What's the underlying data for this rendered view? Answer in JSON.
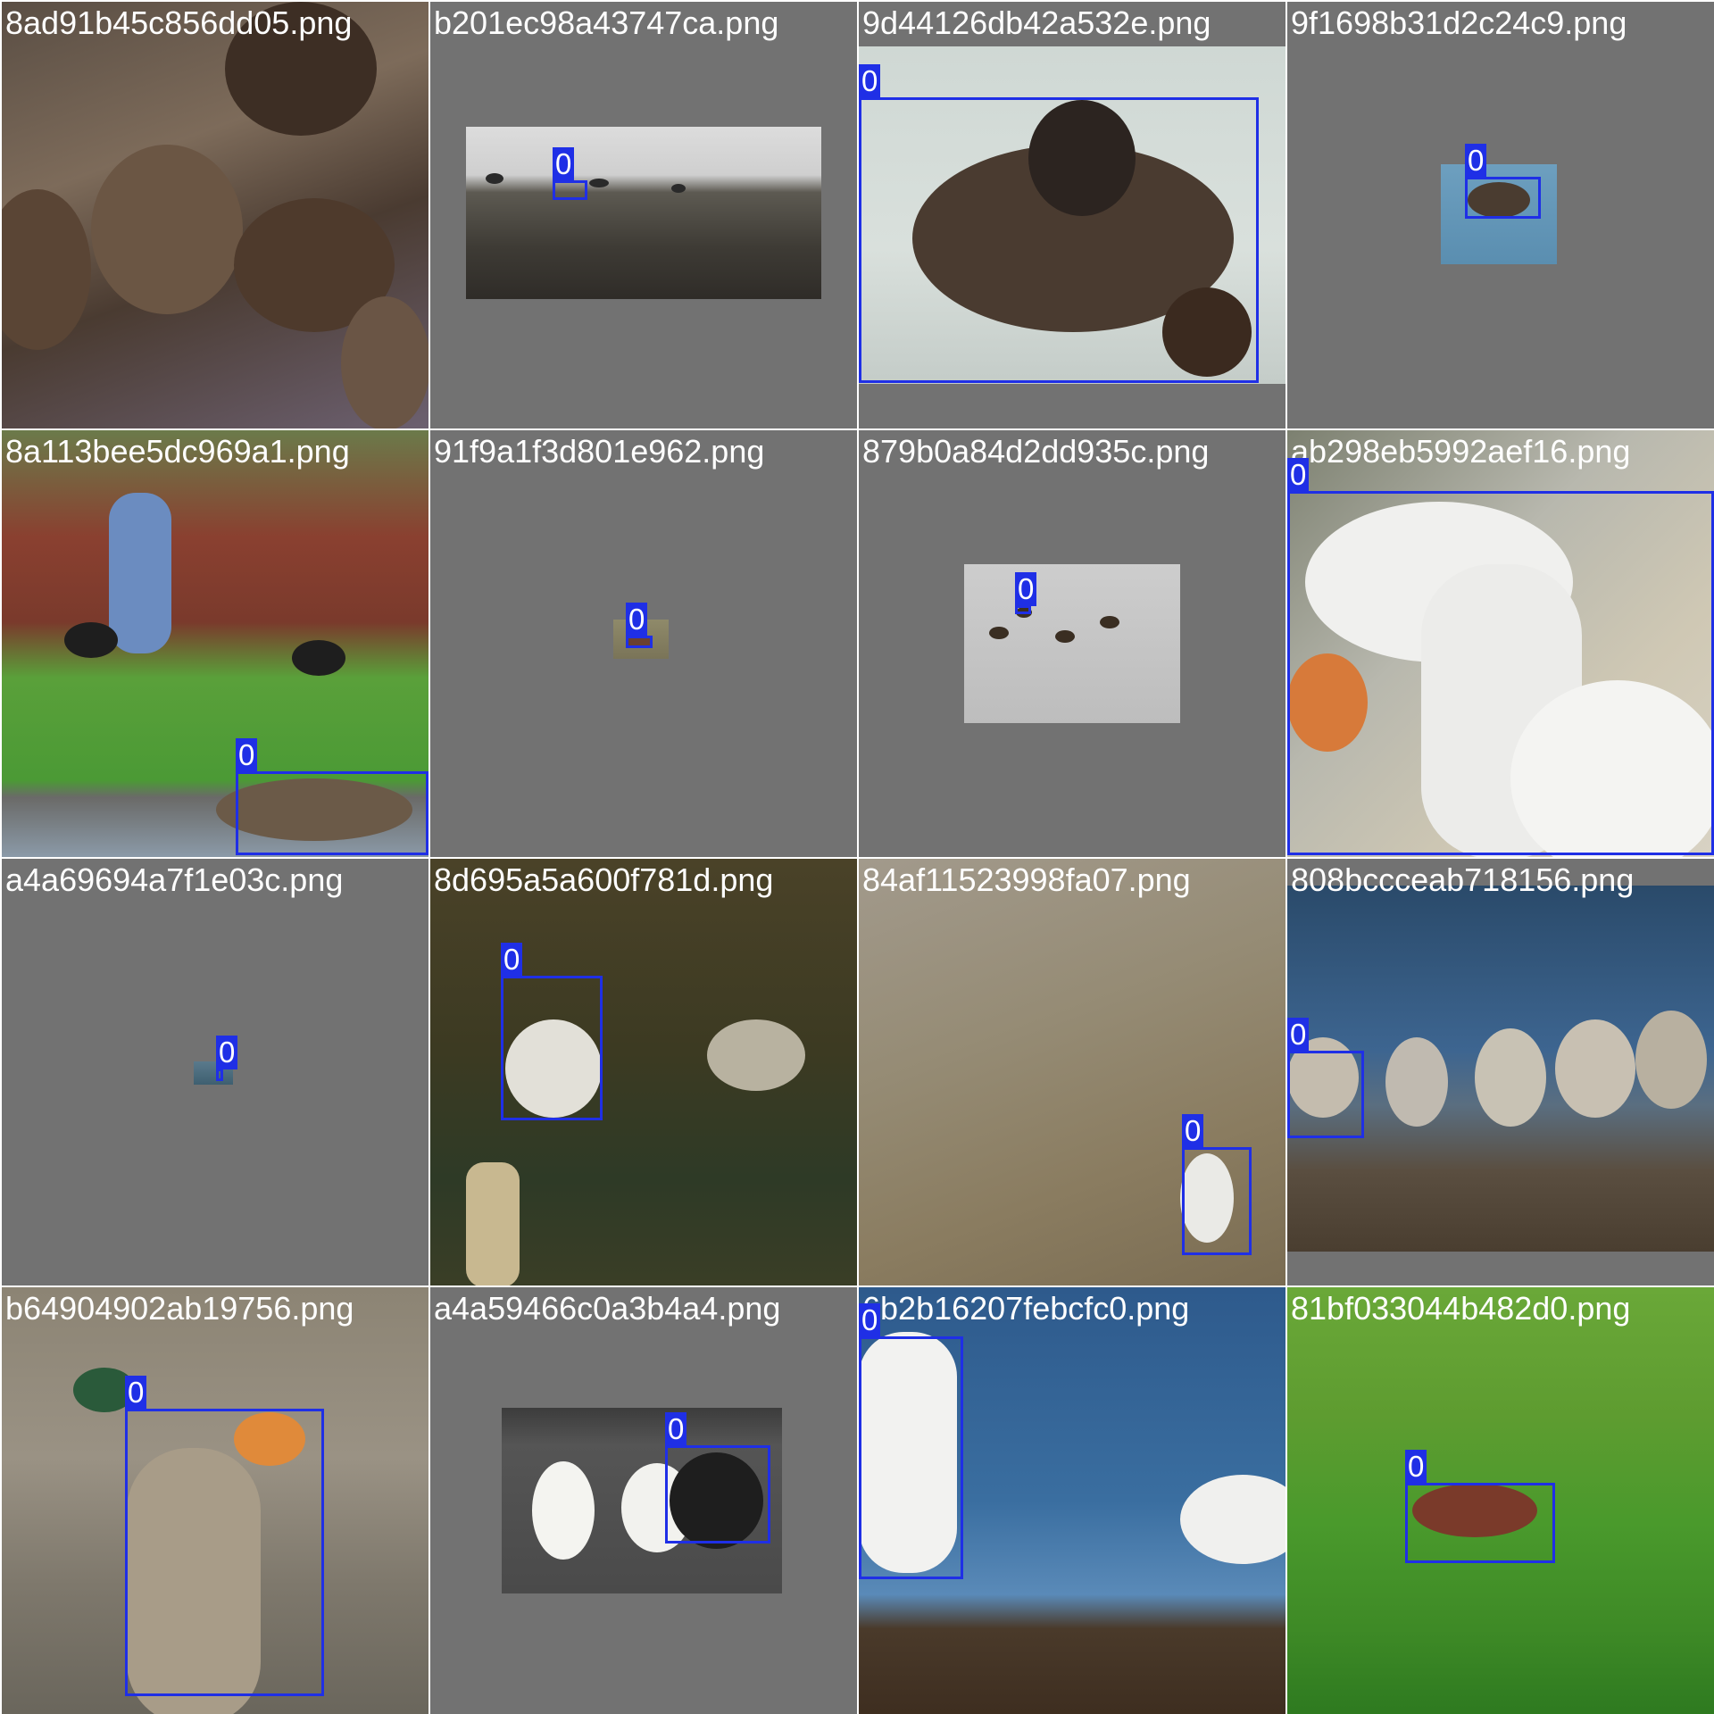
{
  "tiles": [
    {
      "name": "8ad91b45c856dd05.png",
      "boxes": []
    },
    {
      "name": "b201ec98a43747ca.png",
      "boxes": [
        {
          "label": "0"
        }
      ]
    },
    {
      "name": "9d44126db42a532e.png",
      "boxes": [
        {
          "label": "0"
        }
      ]
    },
    {
      "name": "9f1698b31d2c24c9.png",
      "boxes": [
        {
          "label": "0"
        }
      ]
    },
    {
      "name": "8a113bee5dc969a1.png",
      "boxes": [
        {
          "label": "0"
        }
      ]
    },
    {
      "name": "91f9a1f3d801e962.png",
      "boxes": [
        {
          "label": "0"
        }
      ]
    },
    {
      "name": "879b0a84d2dd935c.png",
      "boxes": [
        {
          "label": "0"
        }
      ]
    },
    {
      "name": "ab298eb5992aef16.png",
      "boxes": [
        {
          "label": "0"
        }
      ]
    },
    {
      "name": "a4a69694a7f1e03c.png",
      "boxes": [
        {
          "label": "0"
        }
      ]
    },
    {
      "name": "8d695a5a600f781d.png",
      "boxes": [
        {
          "label": "0"
        }
      ]
    },
    {
      "name": "84af11523998fa07.png",
      "boxes": [
        {
          "label": "0"
        }
      ]
    },
    {
      "name": "808bccceab718156.png",
      "boxes": [
        {
          "label": "0"
        }
      ]
    },
    {
      "name": "b64904902ab19756.png",
      "boxes": [
        {
          "label": "0"
        }
      ]
    },
    {
      "name": "a4a59466c0a3b4a4.png",
      "boxes": [
        {
          "label": "0"
        }
      ]
    },
    {
      "name": "6b2b16207febcfc0.png",
      "boxes": [
        {
          "label": "0"
        }
      ]
    },
    {
      "name": "81bf033044b482d0.png",
      "boxes": [
        {
          "label": "0"
        }
      ]
    }
  ],
  "colors": {
    "letterbox": "#727272",
    "box": "#1f2fe6",
    "label_text": "#ffffff"
  }
}
